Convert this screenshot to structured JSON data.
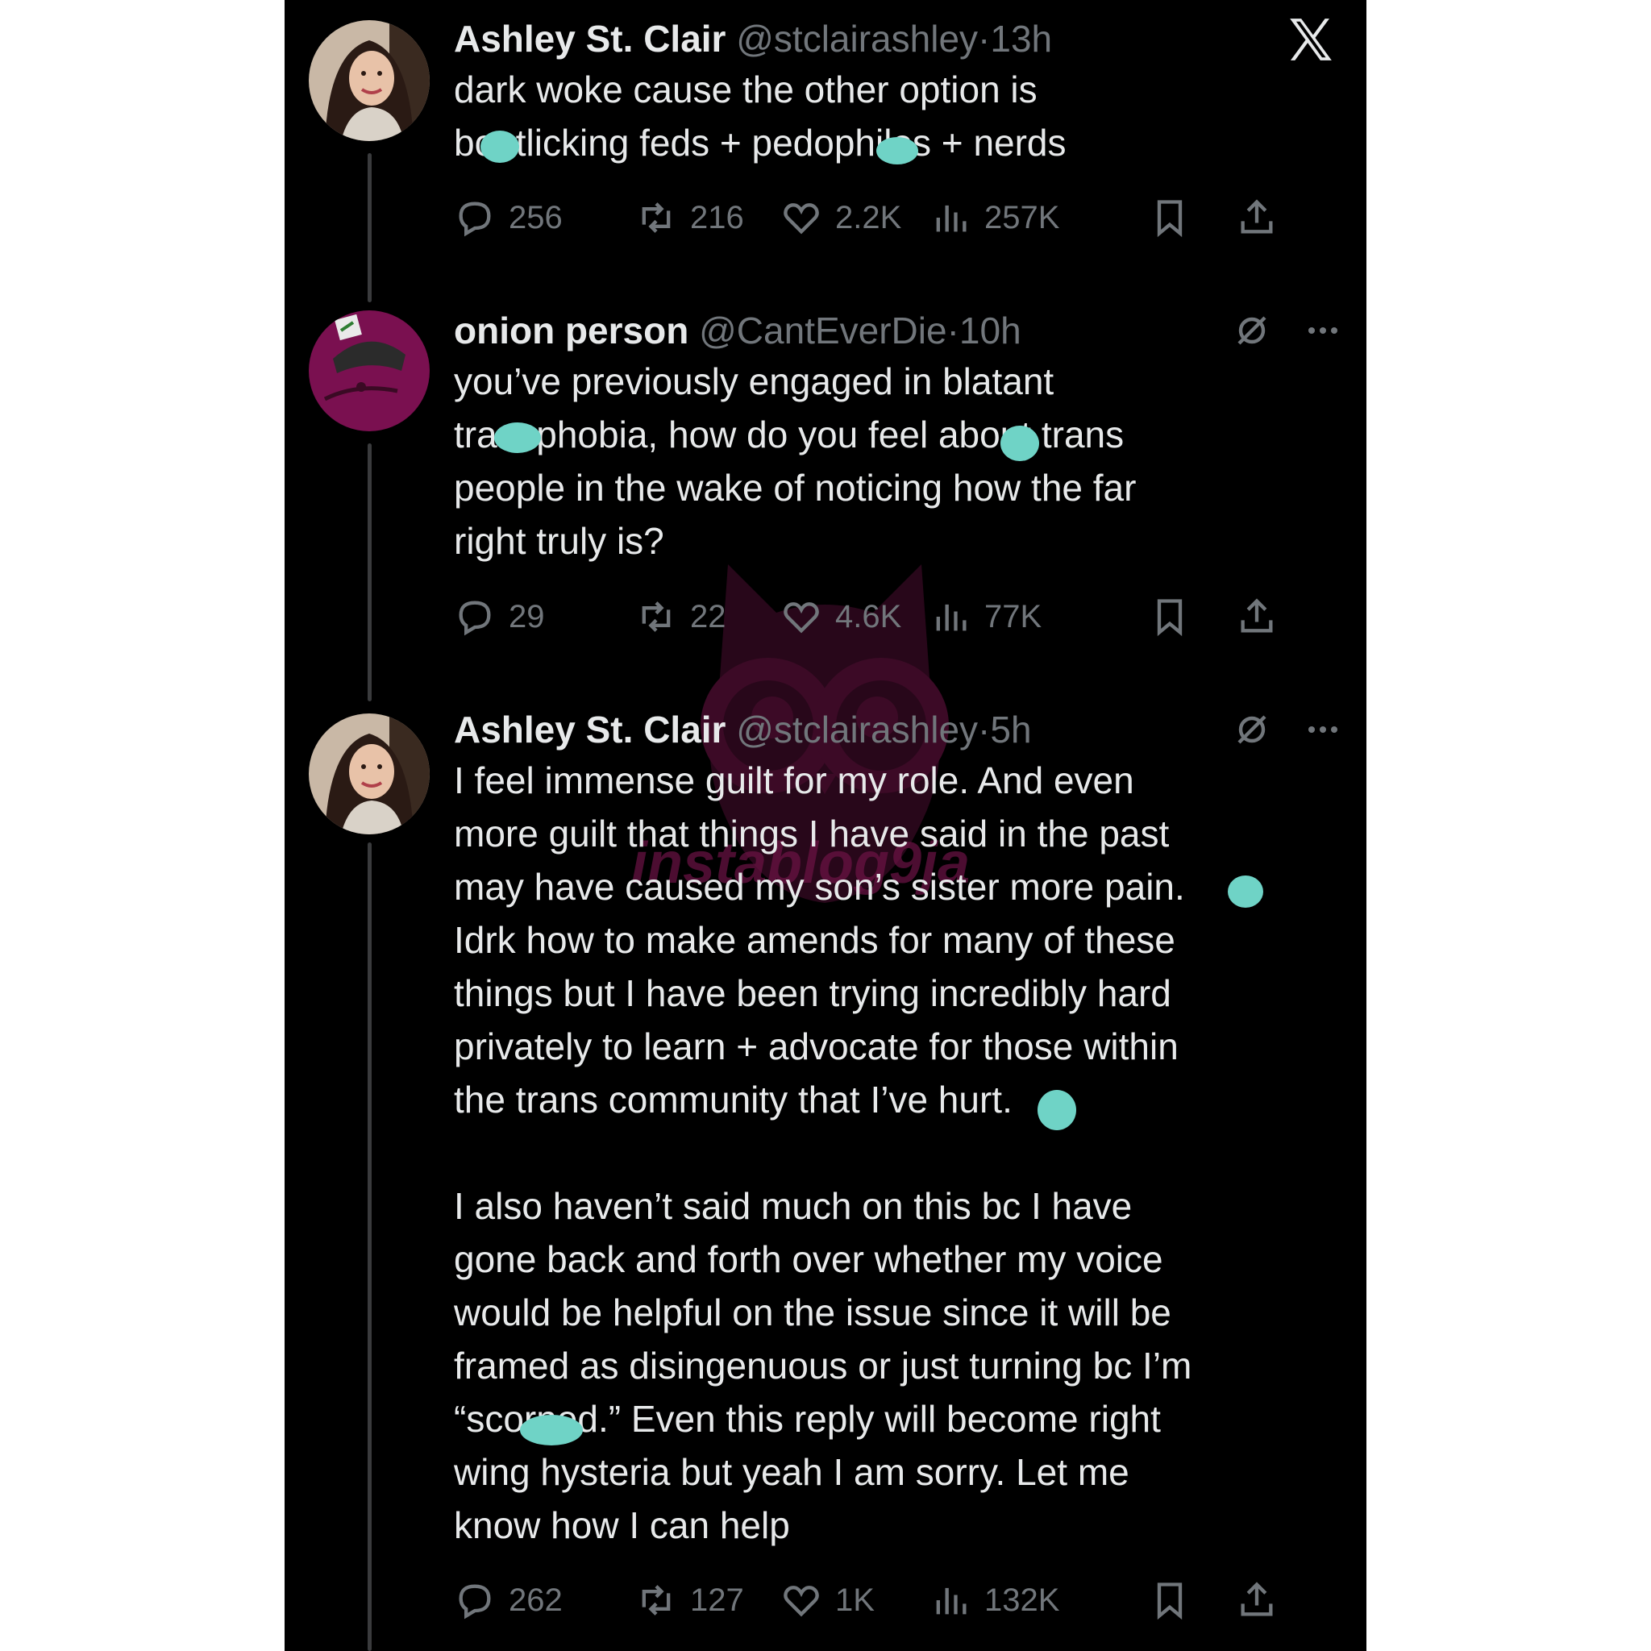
{
  "colors": {
    "background": "#000000",
    "name_text": "#e7e9ea",
    "muted_text": "#71767b",
    "thread_line": "#3a3b3d",
    "redaction_blob": "#6fd3c6",
    "watermark": "#6d1346"
  },
  "app": {
    "logo_icon": "x-logo-icon"
  },
  "watermark": {
    "text": "instablog9ja"
  },
  "tweets": [
    {
      "name": "Ashley St. Clair",
      "handle": "@stclairashley",
      "dot": "·",
      "time": "13h",
      "body": "dark woke cause the other option is\nbootlicking feds + pedophiles + nerds",
      "stats": {
        "replies": "256",
        "reposts": "216",
        "likes": "2.2K",
        "views": "257K"
      }
    },
    {
      "name": "onion person",
      "handle": "@CantEverDie",
      "dot": "·",
      "time": "10h",
      "body": "you’ve previously engaged in blatant\ntransphobia, how do you feel about trans\npeople in the wake of noticing how the far\nright truly is?",
      "stats": {
        "replies": "29",
        "reposts": "22",
        "likes": "4.6K",
        "views": "77K"
      }
    },
    {
      "name": "Ashley St. Clair",
      "handle": "@stclairashley",
      "dot": "·",
      "time": "5h",
      "body": "I feel immense guilt for my role. And even\nmore guilt that things I have said in the past\nmay have caused my son’s sister more pain.\nIdrk how to make amends for many of these\nthings but I have been trying incredibly hard\nprivately to learn + advocate for those within\nthe trans community that I’ve hurt.\n\nI also haven’t said much on this bc I have\ngone back and forth over whether my voice\nwould be helpful on the issue since it will be\nframed as disingenuous or just turning bc I’m\n“scorned.” Even this reply will become right\nwing hysteria but yeah I am sorry. Let me\nknow how I can help",
      "stats": {
        "replies": "262",
        "reposts": "127",
        "likes": "1K",
        "views": "132K"
      }
    }
  ]
}
